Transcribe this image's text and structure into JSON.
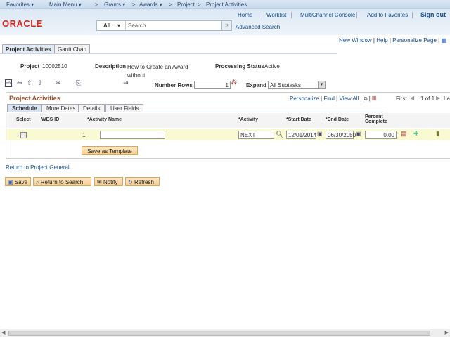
{
  "nav": {
    "favorites": "Favorites ▾",
    "main_menu": "Main Menu ▾",
    "grants": "Grants ▾",
    "awards": "Awards ▾",
    "project": "Project",
    "project_activities": "Project Activities",
    "sep": ">"
  },
  "header": {
    "logo": "ORACLE",
    "links": [
      "Home",
      "Worklist",
      "MultiChannel Console",
      "Add to Favorites",
      "Sign out"
    ],
    "search_scope": "All",
    "search_placeholder": "Search",
    "advanced_search": "Advanced Search"
  },
  "page_links": {
    "new_window": "New Window",
    "help": "Help",
    "personalize_page": "Personalize Page"
  },
  "tabs": [
    "Project Activities",
    "Gantt Chart"
  ],
  "info": {
    "project_label": "Project",
    "project_value": "10002510",
    "description_label": "Description",
    "description_value": "How to Create an Award without",
    "status_label": "Processing Status",
    "status_value": "Active"
  },
  "toolbar": {
    "number_rows_label": "Number Rows",
    "number_rows_value": "1",
    "expand_label": "Expand",
    "expand_value": "All Subtasks"
  },
  "grid": {
    "title": "Project Activities",
    "personalize": "Personalize",
    "find": "Find",
    "view_all": "View All",
    "pager": "First",
    "count": "1 of 1",
    "last": "La",
    "subtabs": [
      "Schedule",
      "More Dates",
      "Details",
      "User Fields"
    ],
    "columns": [
      "Select",
      "WBS ID",
      "*Activity Name",
      "*Activity",
      "*Start Date",
      "*End Date",
      "Percent Complete"
    ],
    "row": {
      "wbs_id": "1",
      "activity_name": "",
      "activity": "NEXT",
      "start_date": "12/01/2014",
      "end_date": "06/30/2050",
      "percent": "0.00"
    }
  },
  "save_template": "Save as Template",
  "return_link": "Return to Project General",
  "buttons": {
    "save": "Save",
    "return_search": "Return to Search",
    "notify": "Notify",
    "refresh": "Refresh"
  },
  "colors": {
    "accent": "#e0231c",
    "link": "#1a4f8b",
    "grid_title": "#a0522d",
    "row_bg": "#fafad2"
  }
}
